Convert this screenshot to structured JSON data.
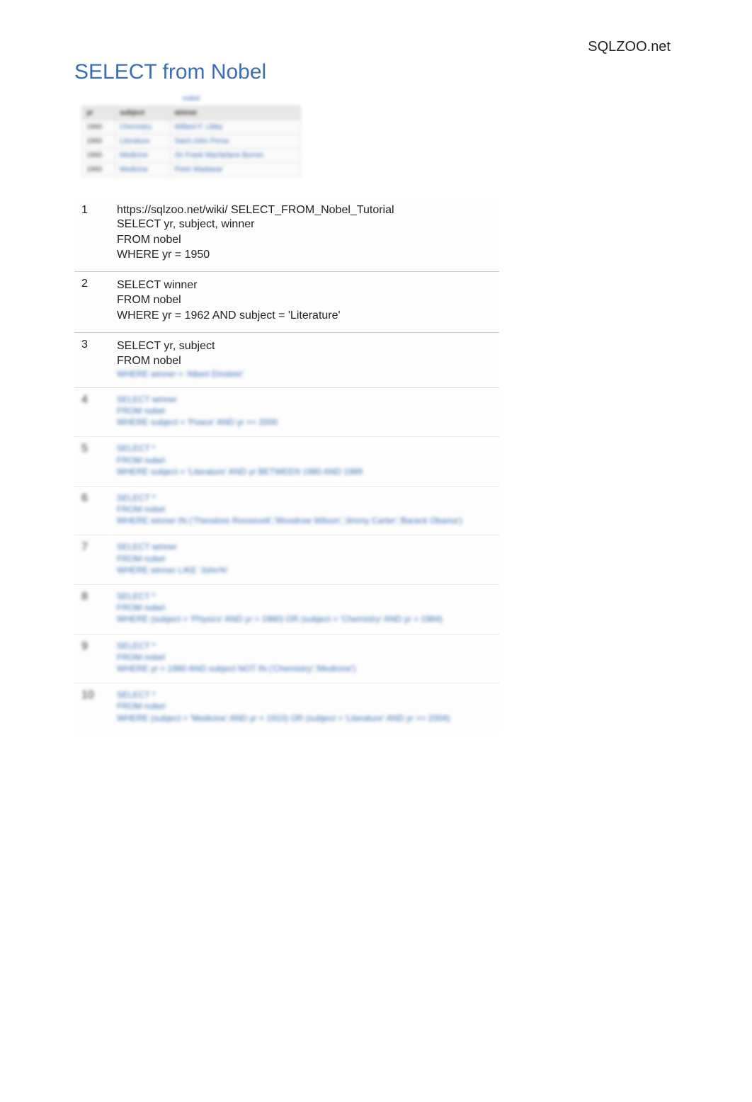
{
  "site_name": "SQLZOO.net",
  "page_title": "SELECT from Nobel",
  "sample_table": {
    "caption": "nobel",
    "headers": [
      "yr",
      "subject",
      "winner"
    ],
    "rows": [
      [
        "1960",
        "Chemistry",
        "Willard F. Libby"
      ],
      [
        "1960",
        "Literature",
        "Saint-John Perse"
      ],
      [
        "1960",
        "Medicine",
        "Sir Frank Macfarlane Burnet"
      ],
      [
        "1960",
        "Medicine",
        "Peter Madawar"
      ]
    ]
  },
  "url": "https://sqlzoo.net/wiki/ SELECT_FROM_Nobel_Tutorial",
  "items": [
    {
      "num": "1",
      "sql": "SELECT yr, subject, winner\nFROM nobel\nWHERE yr = 1950",
      "blurred": false
    },
    {
      "num": "2",
      "sql": "SELECT winner\nFROM nobel\nWHERE yr = 1962 AND subject = 'Literature'",
      "blurred": false
    },
    {
      "num": "3",
      "sql": "SELECT yr, subject\nFROM nobel",
      "sql_blur": "WHERE winner = 'Albert Einstein'",
      "blurred": false,
      "partial": true
    },
    {
      "num": "4",
      "sql": "SELECT winner\nFROM nobel\nWHERE subject = 'Peace' AND yr >= 2000",
      "blurred": true
    },
    {
      "num": "5",
      "sql": "SELECT *\nFROM nobel\nWHERE subject = 'Literature' AND yr BETWEEN 1980 AND 1989",
      "blurred": true
    },
    {
      "num": "6",
      "sql": "SELECT *\nFROM nobel\nWHERE winner IN ('Theodore Roosevelt','Woodrow Wilson','Jimmy Carter','Barack Obama')",
      "blurred": true
    },
    {
      "num": "7",
      "sql": "SELECT winner\nFROM nobel\nWHERE winner LIKE 'John%'",
      "blurred": true
    },
    {
      "num": "8",
      "sql": "SELECT *\nFROM nobel\nWHERE (subject = 'Physics' AND yr = 1980) OR (subject = 'Chemistry' AND yr = 1984)",
      "blurred": true
    },
    {
      "num": "9",
      "sql": "SELECT *\nFROM nobel\nWHERE yr = 1980 AND subject NOT IN ('Chemistry','Medicine')",
      "blurred": true
    },
    {
      "num": "10",
      "sql": "SELECT *\nFROM nobel\nWHERE (subject = 'Medicine' AND yr < 1910) OR (subject = 'Literature' AND yr >= 2004)",
      "blurred": true
    }
  ]
}
